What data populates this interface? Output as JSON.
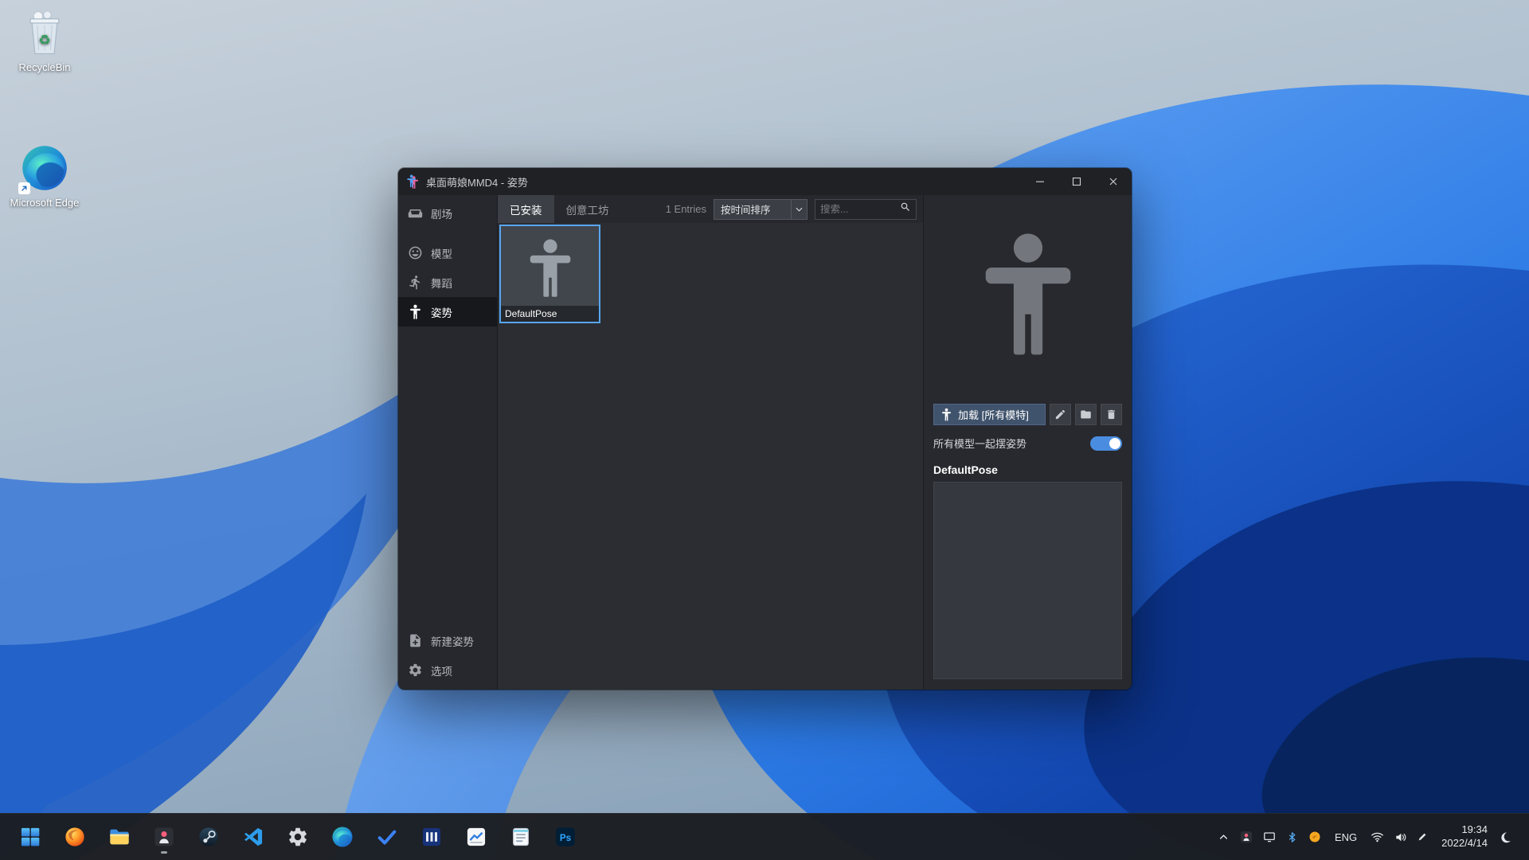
{
  "desktop": {
    "icons": [
      {
        "name": "recycle-bin",
        "label": "RecycleBin"
      },
      {
        "name": "microsoft-edge",
        "label": "Microsoft Edge"
      }
    ]
  },
  "app_window": {
    "title": "桌面萌娘MMD4 - 姿势",
    "window_controls": [
      "minimize",
      "maximize",
      "close"
    ],
    "sidebar": {
      "theater": {
        "label": "剧场",
        "icon": "theater-icon"
      },
      "items": [
        {
          "label": "模型",
          "icon": "model-icon",
          "active": false
        },
        {
          "label": "舞蹈",
          "icon": "dance-icon",
          "active": false
        },
        {
          "label": "姿势",
          "icon": "pose-icon",
          "active": true
        }
      ],
      "bottom_items": [
        {
          "label": "新建姿势",
          "icon": "new-pose-icon"
        },
        {
          "label": "选项",
          "icon": "gear-icon"
        }
      ]
    },
    "tab_bar": {
      "tabs": [
        {
          "label": "已安装",
          "active": true
        },
        {
          "label": "创意工坊",
          "active": false
        }
      ],
      "entries_count": "1 Entries",
      "sort_dropdown_value": "按时间排序",
      "search_placeholder": "搜索..."
    },
    "grid": {
      "items": [
        {
          "label": "DefaultPose",
          "selected": true,
          "icon": "tpose-person-icon"
        }
      ]
    },
    "detail_panel": {
      "preview_icon": "tpose-person-icon",
      "load_button_label": "加载 [所有模特]",
      "tool_icons": [
        "pencil-icon",
        "folder-icon",
        "trash-icon"
      ],
      "toggle_label": "所有模型一起摆姿势",
      "toggle_state": "on",
      "pose_name": "DefaultPose"
    }
  },
  "taskbar": {
    "apps": [
      "start",
      "firefox",
      "file-explorer",
      "mmd-app",
      "steam",
      "vscode",
      "settings",
      "edge",
      "todo",
      "apps-grid",
      "task-monitor",
      "notepad",
      "photoshop"
    ],
    "tray": {
      "icons": [
        "chevron-up",
        "mmd-tray",
        "display",
        "bluetooth",
        "security",
        "wifi",
        "volume",
        "pen",
        "moon"
      ],
      "language": "ENG",
      "time": "19:34",
      "date": "2022/4/14"
    }
  },
  "colors": {
    "selection_blue": "#58a6f2",
    "toggle_on_blue": "#4a8de0",
    "load_button_bg": "#40536c",
    "taskbar_bg": "#1b1d21"
  }
}
